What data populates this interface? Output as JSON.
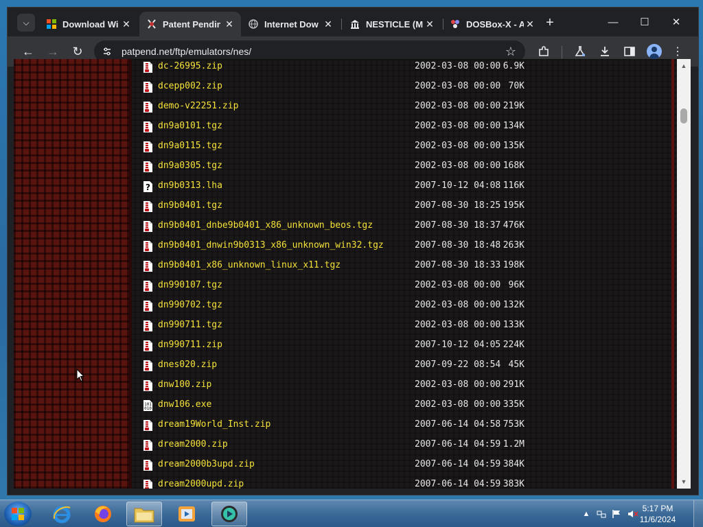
{
  "browser": {
    "tabs": [
      {
        "title": "Download Wi",
        "icon": "windows-logo-icon",
        "active": false
      },
      {
        "title": "Patent Pendin",
        "icon": "patent-pending-icon",
        "active": true
      },
      {
        "title": "Internet Dow",
        "icon": "globe-icon",
        "active": false
      },
      {
        "title": "NESTICLE (M",
        "icon": "archive-building-icon",
        "active": false
      },
      {
        "title": "DOSBox-X - A",
        "icon": "dosbox-icon",
        "active": false
      }
    ],
    "tab_close_glyph": "✕",
    "new_tab_glyph": "+",
    "url": "patpend.net/ftp/emulators/nes/"
  },
  "files": [
    {
      "name": "dc-26995.zip",
      "date": "2002-03-08 00:00",
      "size": "6.9K",
      "type": "archive"
    },
    {
      "name": "dcepp002.zip",
      "date": "2002-03-08 00:00",
      "size": " 70K",
      "type": "archive"
    },
    {
      "name": "demo-v22251.zip",
      "date": "2002-03-08 00:00",
      "size": "219K",
      "type": "archive"
    },
    {
      "name": "dn9a0101.tgz",
      "date": "2002-03-08 00:00",
      "size": "134K",
      "type": "archive"
    },
    {
      "name": "dn9a0115.tgz",
      "date": "2002-03-08 00:00",
      "size": "135K",
      "type": "archive"
    },
    {
      "name": "dn9a0305.tgz",
      "date": "2002-03-08 00:00",
      "size": "168K",
      "type": "archive"
    },
    {
      "name": "dn9b0313.lha",
      "date": "2007-10-12 04:08",
      "size": "116K",
      "type": "unknown"
    },
    {
      "name": "dn9b0401.tgz",
      "date": "2007-08-30 18:25",
      "size": "195K",
      "type": "archive"
    },
    {
      "name": "dn9b0401_dnbe9b0401_x86_unknown_beos.tgz",
      "date": "2007-08-30 18:37",
      "size": "476K",
      "type": "archive"
    },
    {
      "name": "dn9b0401_dnwin9b0313_x86_unknown_win32.tgz",
      "date": "2007-08-30 18:48",
      "size": "263K",
      "type": "archive"
    },
    {
      "name": "dn9b0401_x86_unknown_linux_x11.tgz",
      "date": "2007-08-30 18:33",
      "size": "198K",
      "type": "archive"
    },
    {
      "name": "dn990107.tgz",
      "date": "2002-03-08 00:00",
      "size": " 96K",
      "type": "archive"
    },
    {
      "name": "dn990702.tgz",
      "date": "2002-03-08 00:00",
      "size": "132K",
      "type": "archive"
    },
    {
      "name": "dn990711.tgz",
      "date": "2002-03-08 00:00",
      "size": "133K",
      "type": "archive"
    },
    {
      "name": "dn990711.zip",
      "date": "2007-10-12 04:05",
      "size": "224K",
      "type": "archive"
    },
    {
      "name": "dnes020.zip",
      "date": "2007-09-22 08:54",
      "size": " 45K",
      "type": "archive"
    },
    {
      "name": "dnw100.zip",
      "date": "2002-03-08 00:00",
      "size": "291K",
      "type": "archive"
    },
    {
      "name": "dnw106.exe",
      "date": "2002-03-08 00:00",
      "size": "335K",
      "type": "binary"
    },
    {
      "name": "dream19World_Inst.zip",
      "date": "2007-06-14 04:58",
      "size": "753K",
      "type": "archive"
    },
    {
      "name": "dream2000.zip",
      "date": "2007-06-14 04:59",
      "size": "1.2M",
      "type": "archive"
    },
    {
      "name": "dream2000b3upd.zip",
      "date": "2007-06-14 04:59",
      "size": "384K",
      "type": "archive"
    },
    {
      "name": "dream2000upd.zip",
      "date": "2007-06-14 04:59",
      "size": "383K",
      "type": "archive"
    }
  ],
  "taskbar": {
    "clock_time": "5:17 PM",
    "clock_date": "11/6/2024"
  },
  "colors": {
    "link": "#f5e23a",
    "text": "#e8e8e8",
    "strip": "#5a1410"
  }
}
